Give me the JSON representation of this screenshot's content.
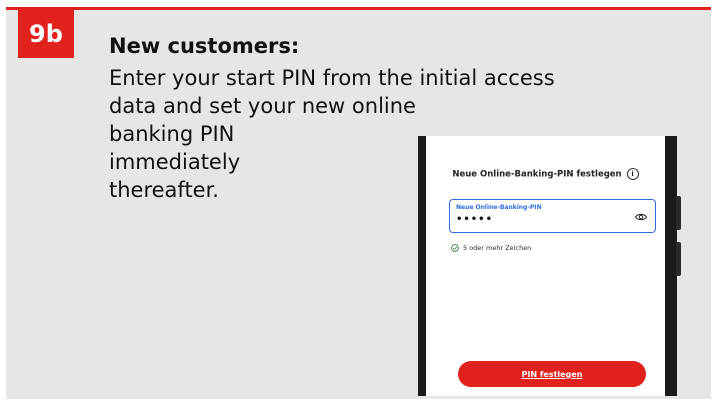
{
  "step": {
    "badge": "9b"
  },
  "instructions": {
    "heading": "New customers:",
    "lines": [
      "Enter your start PIN from the initial access",
      "data and set your new online",
      "banking PIN",
      "immediately",
      "thereafter."
    ]
  },
  "phone": {
    "screen_title": "Neue Online-Banking-PIN festlegen",
    "info_icon": "info-icon",
    "pin_field": {
      "label": "Neue Online-Banking-PIN",
      "value": "•••••"
    },
    "visibility_icon": "eye-icon",
    "hint": {
      "icon": "check-circle-icon",
      "text": "5 oder mehr Zeichen"
    },
    "submit_label": "PIN festlegen"
  },
  "colors": {
    "accent": "#e1211b",
    "panel": "#e6e6e6",
    "focus": "#2d6cdf",
    "success": "#2e7d32"
  }
}
